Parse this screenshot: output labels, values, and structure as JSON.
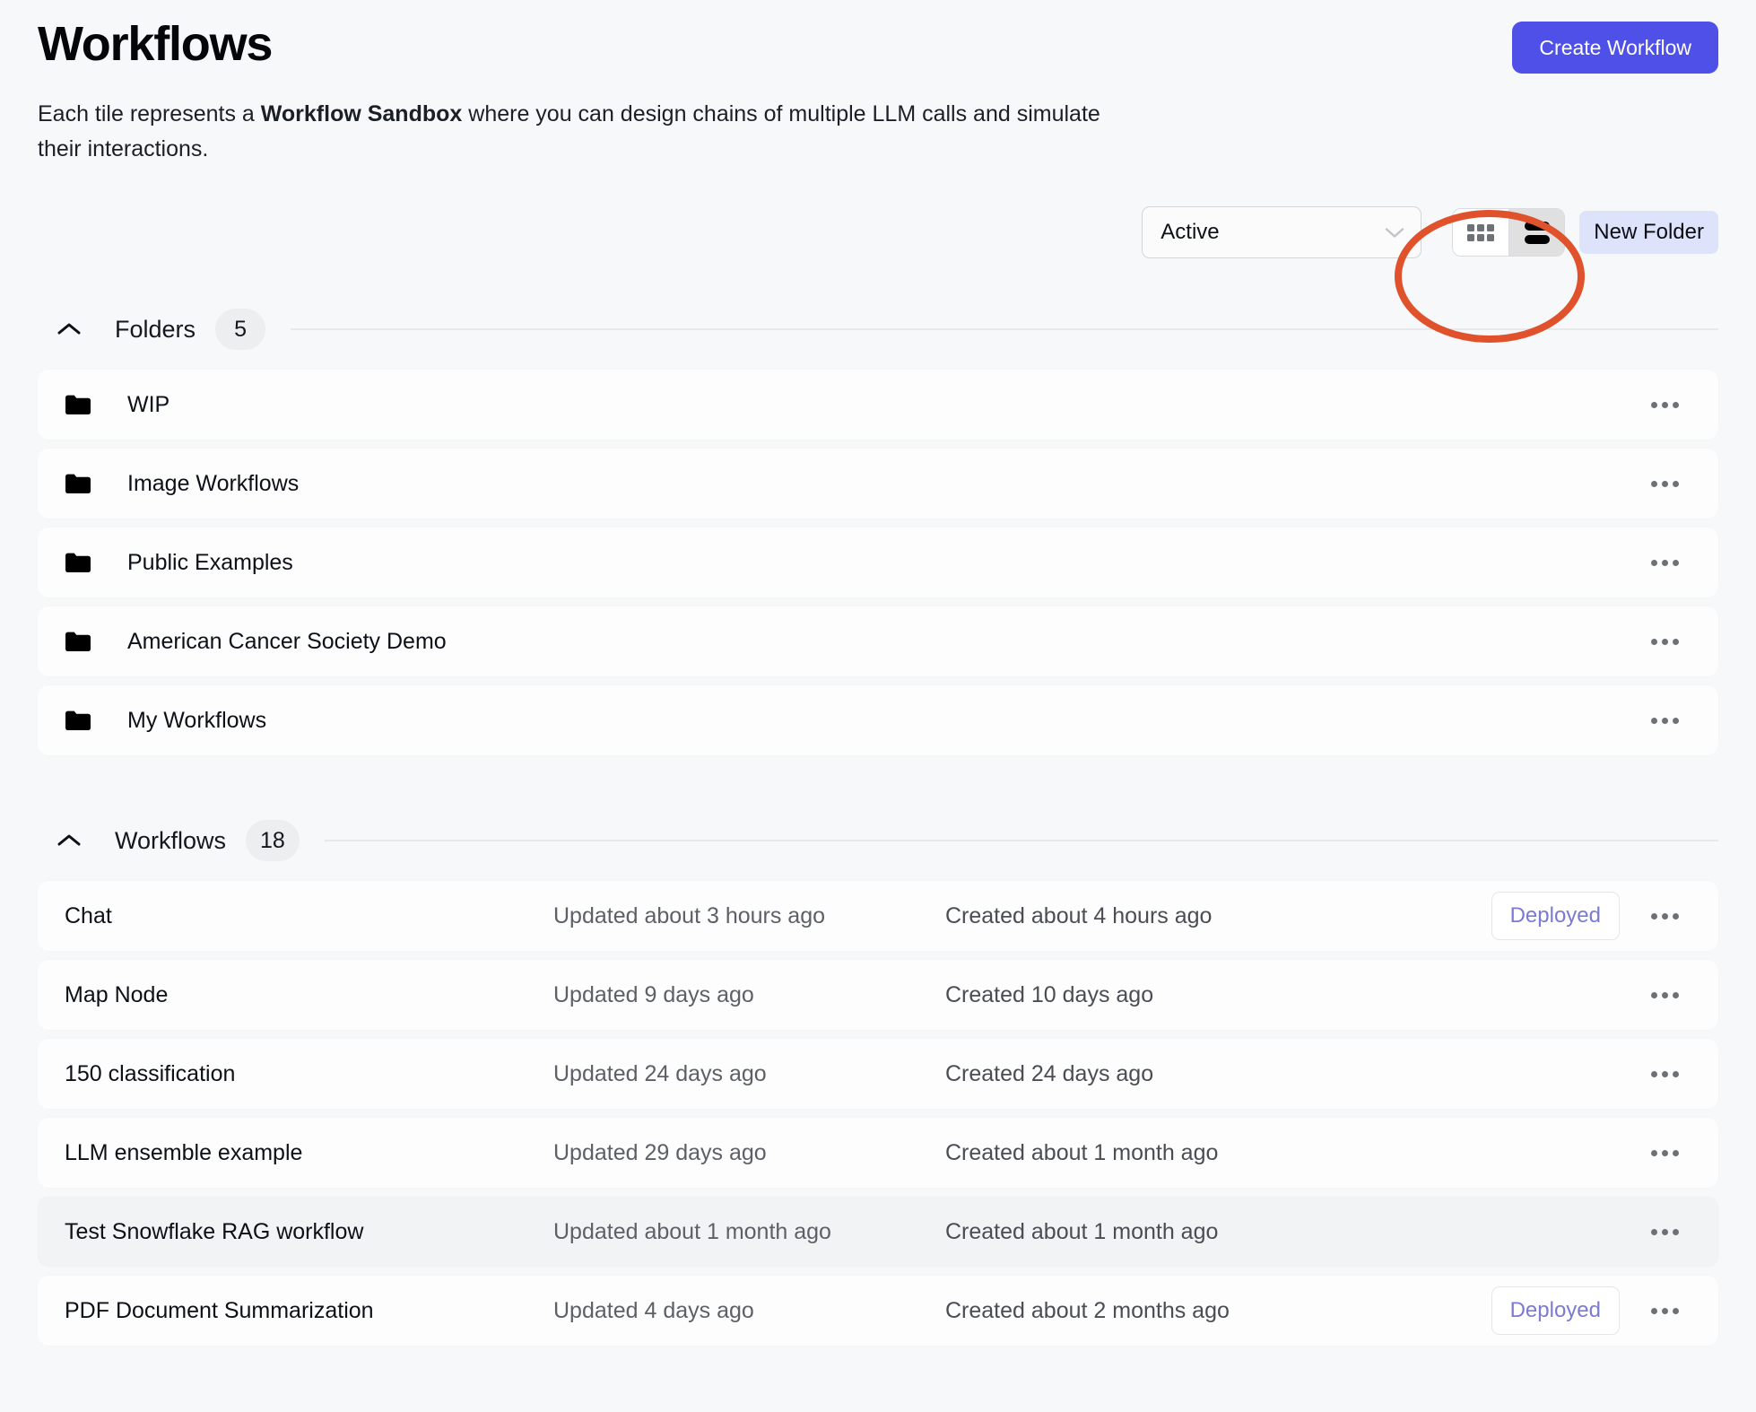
{
  "header": {
    "title": "Workflows",
    "subtitle_part1": "Each tile represents a ",
    "subtitle_bold": "Workflow Sandbox",
    "subtitle_part2": " where you can design chains of multiple LLM calls and simulate their interactions.",
    "create_button": "Create Workflow"
  },
  "toolbar": {
    "status_filter_value": "Active",
    "grid_view_label": "Grid view",
    "list_view_label": "List view",
    "new_folder_button": "New Folder",
    "active_view": "list",
    "annotation_color": "#e0522c"
  },
  "folders_section": {
    "label": "Folders",
    "count": "5",
    "items": [
      {
        "name": "WIP"
      },
      {
        "name": "Image Workflows"
      },
      {
        "name": "Public Examples"
      },
      {
        "name": "American Cancer Society Demo"
      },
      {
        "name": "My Workflows"
      }
    ]
  },
  "workflows_section": {
    "label": "Workflows",
    "count": "18",
    "items": [
      {
        "name": "Chat",
        "updated": "Updated about 3 hours ago",
        "created": "Created about 4 hours ago",
        "status": "Deployed",
        "hovered": false
      },
      {
        "name": "Map Node",
        "updated": "Updated 9 days ago",
        "created": "Created 10 days ago",
        "status": "",
        "hovered": false
      },
      {
        "name": "150 classification",
        "updated": "Updated 24 days ago",
        "created": "Created 24 days ago",
        "status": "",
        "hovered": false
      },
      {
        "name": "LLM ensemble example",
        "updated": "Updated 29 days ago",
        "created": "Created about 1 month ago",
        "status": "",
        "hovered": false
      },
      {
        "name": "Test Snowflake RAG workflow",
        "updated": "Updated about 1 month ago",
        "created": "Created about 1 month ago",
        "status": "",
        "hovered": true
      },
      {
        "name": "PDF Document Summarization",
        "updated": "Updated 4 days ago",
        "created": "Created about 2 months ago",
        "status": "Deployed",
        "hovered": false
      }
    ]
  },
  "colors": {
    "accent": "#4f50e8",
    "new_folder_bg": "#dde3fb",
    "deployed_text": "#7a7bd1",
    "page_bg": "#f7f8f9",
    "annotation": "#e0522c"
  },
  "icons": {
    "folder": "folder-icon",
    "chevron_down": "chevron-down-icon",
    "chevron_up": "chevron-up-icon",
    "overflow": "overflow-menu-icon",
    "grid": "grid-view-icon",
    "list": "list-view-icon"
  }
}
